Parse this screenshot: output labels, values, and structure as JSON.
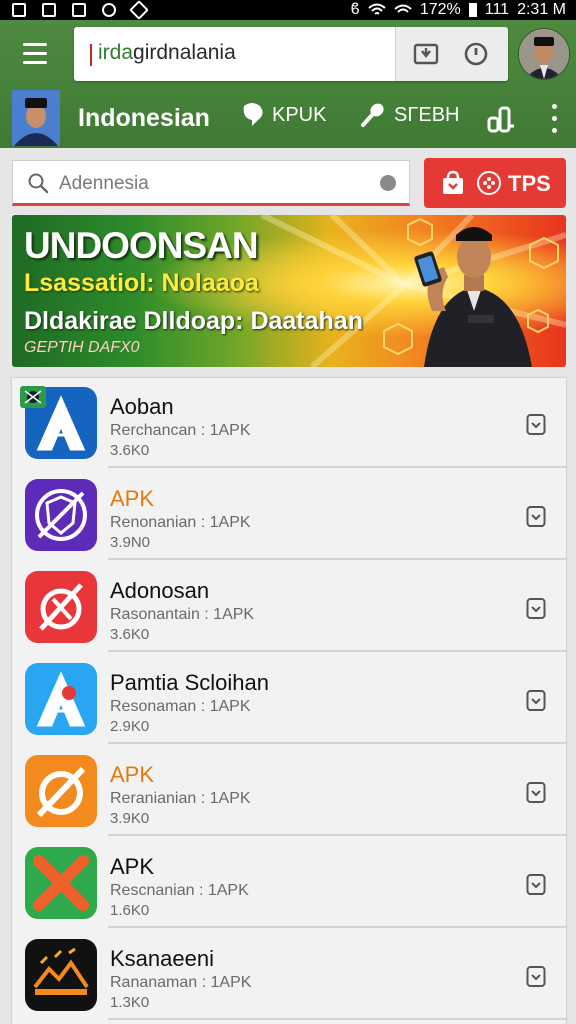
{
  "status_bar": {
    "battery_text": "172%",
    "signal_text": "111",
    "time": "2:31 M"
  },
  "browser": {
    "url_prefix": "irda",
    "url_rest": "girdnalania"
  },
  "header": {
    "title": "Indonesian",
    "action_1": "KPUK",
    "action_2": "SΓEBH"
  },
  "search": {
    "placeholder": "Adennesia",
    "button_label": "TPS"
  },
  "banner": {
    "title": "UNDOONSAN",
    "subtitle": "Lsassatiol: Nolaaoa",
    "headline": "Dldakirae Dlldoap: Daatahan",
    "tag": "GEPTIH DAFX0"
  },
  "apps": [
    {
      "name": "Aoban",
      "meta": "Rerchancan : 1APK",
      "size": "3.6K0",
      "icon": "letter-a-icon",
      "color": "#1565c0",
      "name_color": "dark"
    },
    {
      "name": "APK",
      "meta": "Renonanian : 1APK",
      "size": "3.9N0",
      "icon": "shield-hand-icon",
      "color": "#5e2bb8",
      "name_color": "orange"
    },
    {
      "name": "Adonosan",
      "meta": "Rasonantain : 1APK",
      "size": "3.6K0",
      "icon": "crossed-circle-icon",
      "color": "#e8363a",
      "name_color": "dark"
    },
    {
      "name": "Pamtia Scloihan",
      "meta": "Resonaman : 1APK",
      "size": "2.9K0",
      "icon": "letter-a-dot-icon",
      "color": "#29a6f2",
      "name_color": "dark"
    },
    {
      "name": "APK",
      "meta": "Reranianian : 1APK",
      "size": "3.9K0",
      "icon": "wrench-circle-icon",
      "color": "#f28a1e",
      "name_color": "orange"
    },
    {
      "name": "APK",
      "meta": "Rescnanian : 1APK",
      "size": "1.6K0",
      "icon": "x-mark-icon",
      "color": "#2eaa4c",
      "name_color": "dark"
    },
    {
      "name": "Ksanaeeni",
      "meta": "Rananaman : 1APK",
      "size": "1.3K0",
      "icon": "mountain-logo-icon",
      "color": "#111111",
      "name_color": "dark"
    }
  ],
  "colors": {
    "header_green": "#4f8a41",
    "accent_red": "#e53935",
    "list_bg": "#f2f2f2"
  }
}
